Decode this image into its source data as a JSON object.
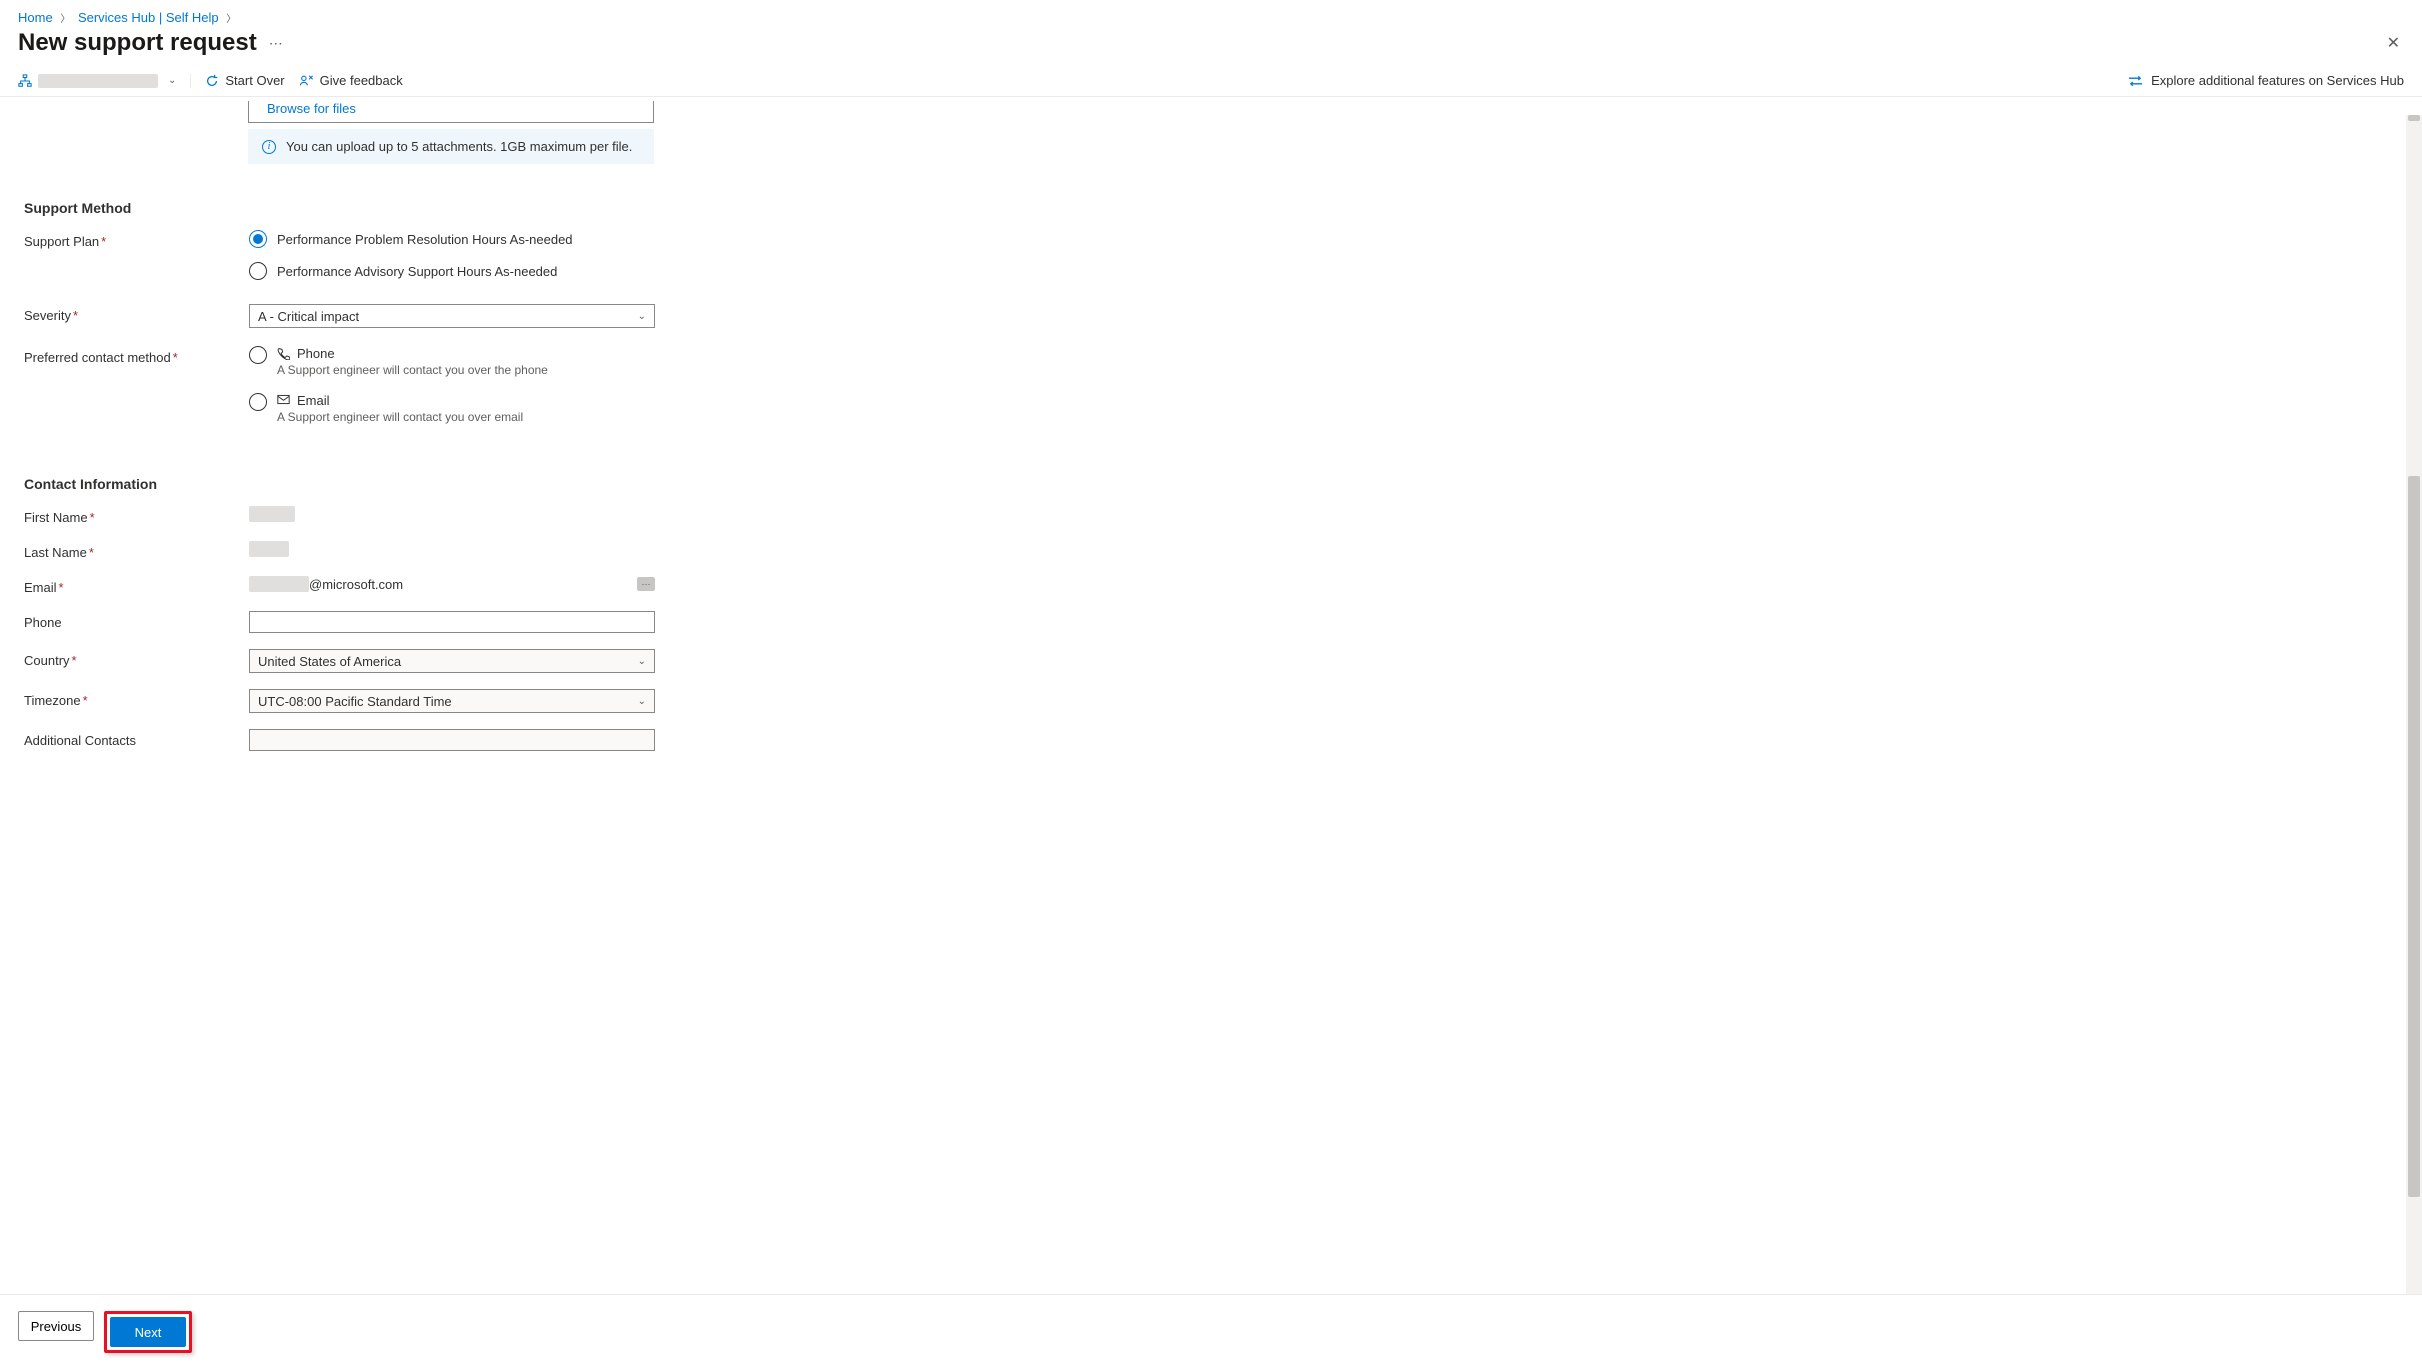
{
  "breadcrumb": {
    "home": "Home",
    "services": "Services Hub | Self Help"
  },
  "page": {
    "title": "New support request"
  },
  "toolbar": {
    "start_over": "Start Over",
    "give_feedback": "Give feedback",
    "explore_link": "Explore additional features on Services Hub"
  },
  "upload": {
    "browse": "Browse for files",
    "info": "You can upload up to 5 attachments. 1GB maximum per file."
  },
  "sections": {
    "support_method": "Support Method",
    "contact_info": "Contact Information"
  },
  "fields": {
    "support_plan": {
      "label": "Support Plan",
      "option1": "Performance Problem Resolution Hours As-needed",
      "option2": "Performance Advisory Support Hours As-needed"
    },
    "severity": {
      "label": "Severity",
      "value": "A - Critical impact"
    },
    "contact_method": {
      "label": "Preferred contact method",
      "phone_label": "Phone",
      "phone_desc": "A Support engineer will contact you over the phone",
      "email_label": "Email",
      "email_desc": "A Support engineer will contact you over email"
    },
    "first_name": {
      "label": "First Name"
    },
    "last_name": {
      "label": "Last Name"
    },
    "email": {
      "label": "Email",
      "domain": "@microsoft.com"
    },
    "phone": {
      "label": "Phone"
    },
    "country": {
      "label": "Country",
      "value": "United States of America"
    },
    "timezone": {
      "label": "Timezone",
      "value": "UTC-08:00 Pacific Standard Time"
    },
    "additional": {
      "label": "Additional Contacts"
    }
  },
  "footer": {
    "previous": "Previous",
    "next": "Next"
  }
}
